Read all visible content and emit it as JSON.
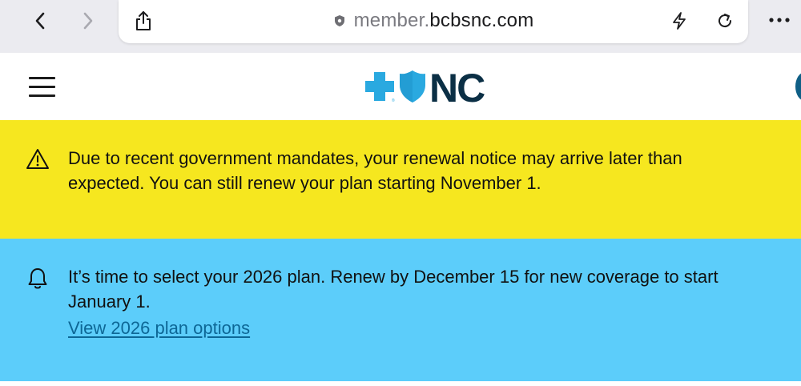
{
  "browser": {
    "url_prefix": "member.",
    "url_domain": "bcbsnc.com",
    "back_icon": "chevron-left-icon",
    "forward_icon": "chevron-right-icon",
    "share_icon": "share-icon",
    "lock_icon": "shield-lock-icon",
    "bolt_icon": "bolt-icon",
    "reload_icon": "reload-icon",
    "more_icon": "more-dots-icon"
  },
  "header": {
    "menu_icon": "hamburger-menu-icon",
    "logo_text": "NC",
    "brand_colors": {
      "cross": "#2aa9e0",
      "shield": "#2aa9e0",
      "text": "#0b2f45"
    }
  },
  "alerts": [
    {
      "type": "warning",
      "icon": "warning-triangle-icon",
      "text_line1": "Due to recent government mandates, your renewal notice may arrive later than",
      "text_line2": "expected. You can still renew your plan starting November 1.",
      "background": "#f6e71f"
    },
    {
      "type": "info",
      "icon": "bell-icon",
      "text_line1": "It’s time to select your 2026 plan. Renew by December 15 for new coverage to start",
      "text_line2": "January 1.",
      "link_text": "View 2026 plan options",
      "background": "#5ccdfa"
    }
  ]
}
